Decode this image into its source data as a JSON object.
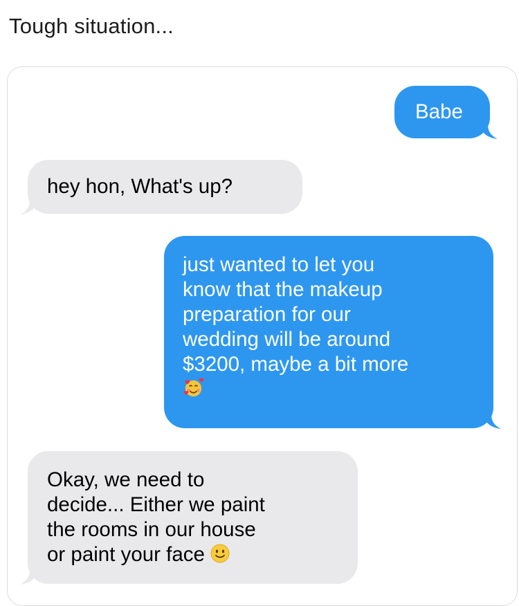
{
  "post": {
    "title": "Tough situation..."
  },
  "conversation": {
    "messages": [
      {
        "sender": "me",
        "text": "Babe"
      },
      {
        "sender": "them",
        "text": "hey hon, What's up?"
      },
      {
        "sender": "me",
        "text": "just wanted to let you\nknow that the makeup\npreparation for our\nwedding will be around\n$3200, maybe a bit more",
        "emoji": "smiling-face-with-hearts-emoji"
      },
      {
        "sender": "them",
        "text": "Okay, we need to\ndecide... Either we paint\nthe rooms in our house\nor paint your face",
        "emoji": "slightly-smiling-face-emoji"
      }
    ]
  },
  "colors": {
    "sent_bubble": "#2d97f0",
    "received_bubble": "#e9e9eb",
    "sent_text": "#ffffff",
    "received_text": "#000000"
  }
}
